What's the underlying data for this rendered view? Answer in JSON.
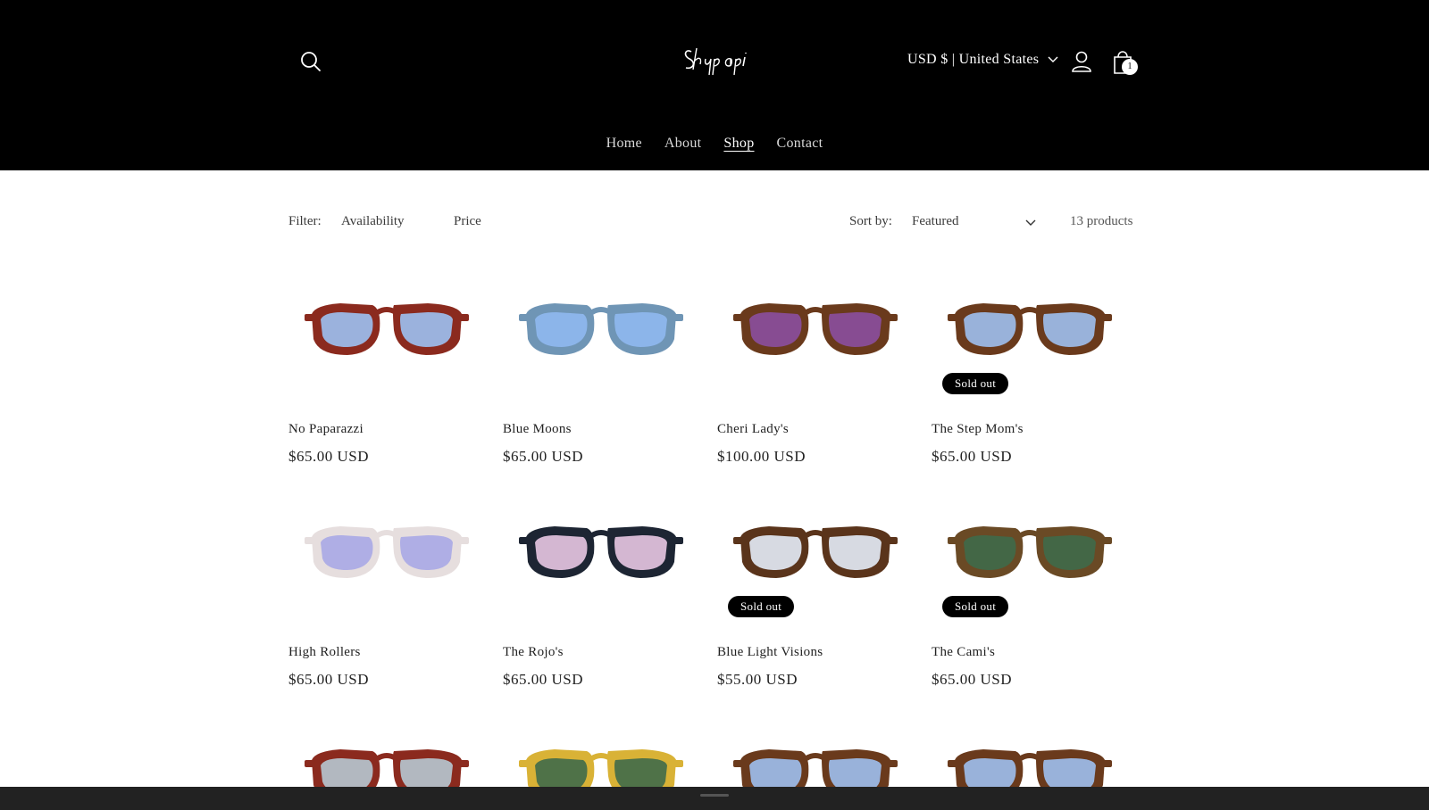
{
  "header": {
    "currency_label": "USD $ | United States",
    "cart_count": "1",
    "nav": [
      {
        "label": "Home"
      },
      {
        "label": "About"
      },
      {
        "label": "Shop",
        "active": true
      },
      {
        "label": "Contact"
      }
    ],
    "logo_text": "Shpapi"
  },
  "filters": {
    "filter_label": "Filter:",
    "availability_label": "Availability",
    "price_label": "Price",
    "sort_label": "Sort by:",
    "sort_value": "Featured",
    "product_count": "13 products"
  },
  "products": [
    {
      "name": "No Paparazzi",
      "price": "$65.00 USD",
      "sold_out": false,
      "frame": "#8b2a1e",
      "lens": "#9cc1f2"
    },
    {
      "name": "Blue Moons",
      "price": "$65.00 USD",
      "sold_out": false,
      "frame": "#6f95b5",
      "lens": "#8fb8f0"
    },
    {
      "name": "Cheri Lady's",
      "price": "$100.00 USD",
      "sold_out": false,
      "frame": "#6a3a1c",
      "lens": "#8b4fa0"
    },
    {
      "name": "The Step Mom's",
      "price": "$65.00 USD",
      "sold_out": true,
      "frame": "#6a3a1c",
      "lens": "#9fc0f0"
    },
    {
      "name": "High Rollers",
      "price": "$65.00 USD",
      "sold_out": false,
      "frame": "#e6dede",
      "lens": "#a9a8e6"
    },
    {
      "name": "The Rojo's",
      "price": "$65.00 USD",
      "sold_out": false,
      "frame": "#1d2533",
      "lens": "#e9c8e3"
    },
    {
      "name": "Blue Light Visions",
      "price": "$55.00 USD",
      "sold_out": true,
      "frame": "#5a341b",
      "lens": "#e4ecf8"
    },
    {
      "name": "The Cami's",
      "price": "$65.00 USD",
      "sold_out": true,
      "frame": "#6a4a25",
      "lens": "#3f6a4a"
    }
  ],
  "partial_products": [
    {
      "frame": "#8b2a1e",
      "lens": "#b6c8d2"
    },
    {
      "frame": "#d9b236",
      "lens": "#3f6a4a"
    },
    {
      "frame": "#6a3a1c",
      "lens": "#9fc0f0"
    },
    {
      "frame": "#6a3a1c",
      "lens": "#9fc0f0"
    }
  ],
  "badge_label": "Sold out"
}
